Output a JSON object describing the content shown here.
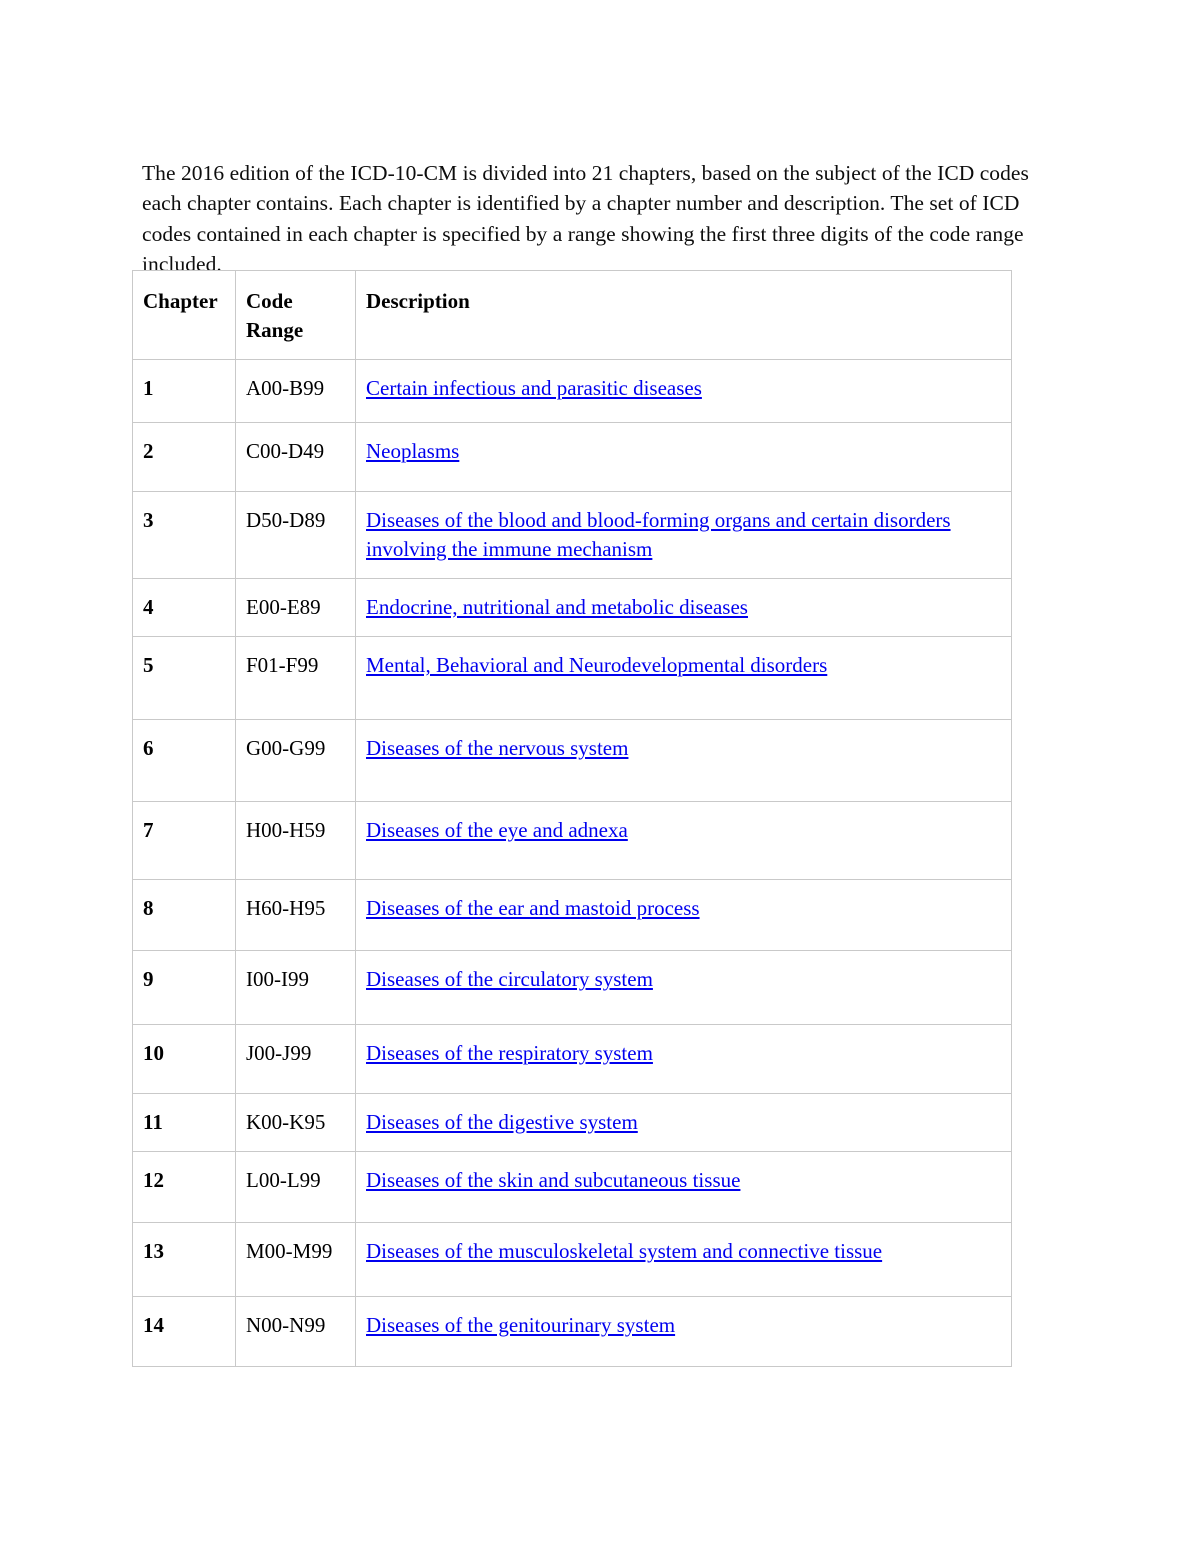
{
  "document": {
    "intro_paragraph": "The 2016 edition of the ICD-10-CM is divided into 21 chapters, based on the subject of the ICD codes each chapter contains. Each chapter is identified by a chapter number and description. The set of ICD codes contained in each chapter is specified by a range showing the first three digits of the code range included."
  },
  "table": {
    "headers": {
      "chapter": "Chapter",
      "code_range": "Code Range",
      "description": "Description"
    },
    "link_color": "#0000ee",
    "border_color": "#c9c9c9",
    "rows": [
      {
        "chapter": "1",
        "code_range": "A00-B99",
        "description": "Certain infectious and parasitic diseases"
      },
      {
        "chapter": "2",
        "code_range": "C00-D49",
        "description": "Neoplasms"
      },
      {
        "chapter": "3",
        "code_range": "D50-D89",
        "description": "Diseases of the blood and blood-forming organs and certain disorders involving the immune mechanism"
      },
      {
        "chapter": "4",
        "code_range": "E00-E89",
        "description": "Endocrine, nutritional and metabolic diseases"
      },
      {
        "chapter": "5",
        "code_range": "F01-F99",
        "description": "Mental, Behavioral and Neurodevelopmental disorders"
      },
      {
        "chapter": "6",
        "code_range": "G00-G99",
        "description": "Diseases of the nervous system"
      },
      {
        "chapter": "7",
        "code_range": "H00-H59",
        "description": "Diseases of the eye and adnexa"
      },
      {
        "chapter": "8",
        "code_range": "H60-H95",
        "description": "Diseases of the ear and mastoid process"
      },
      {
        "chapter": "9",
        "code_range": "I00-I99",
        "description": "Diseases of the circulatory system"
      },
      {
        "chapter": "10",
        "code_range": "J00-J99",
        "description": "Diseases of the respiratory system"
      },
      {
        "chapter": "11",
        "code_range": "K00-K95",
        "description": "Diseases of the digestive system"
      },
      {
        "chapter": "12",
        "code_range": "L00-L99",
        "description": "Diseases of the skin and subcutaneous tissue"
      },
      {
        "chapter": "13",
        "code_range": "M00-M99",
        "description": "Diseases of the musculoskeletal system and connective tissue"
      },
      {
        "chapter": "14",
        "code_range": "N00-N99",
        "description": "Diseases of the genitourinary system"
      }
    ]
  }
}
